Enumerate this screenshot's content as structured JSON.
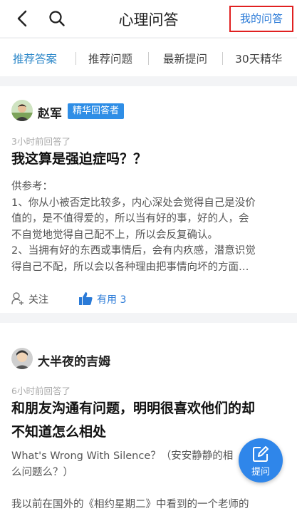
{
  "header": {
    "title": "心理问答",
    "my_answers_label": "我的问答",
    "back_icon": "chevron-left-icon",
    "search_icon": "search-icon"
  },
  "tabs": [
    {
      "label": "推荐答案",
      "active": true
    },
    {
      "label": "推荐问题",
      "active": false
    },
    {
      "label": "最新提问",
      "active": false
    },
    {
      "label": "30天精华",
      "active": false
    }
  ],
  "cards": [
    {
      "author": "赵军",
      "badge": "精华回答者",
      "time": "3小时前回答了",
      "question": "我这算是强迫症吗？？",
      "answer_lines": [
        "供参考：",
        "1、你从小被否定比较多，内心深处会觉得自己是没价",
        "值的，是不值得爱的，所以当有好的事，好的人，会",
        "不自觉地觉得自己配不上，所以会反复确认。",
        "2、当拥有好的东西或事情后，会有内疚感，潜意识觉",
        "得自己不配，所以会以各种理由把事情向坏的方面…"
      ],
      "follow_label": "关注",
      "useful_label": "有用 3"
    },
    {
      "author": "大半夜的吉姆",
      "time": "6小时前回答了",
      "question_lines": [
        "和朋友沟通有问题，明明很喜欢他们的却",
        "不知道怎么相处"
      ],
      "answer_lines": [
        "What's Wrong With Silence？（安安静静的相",
        "么问题么？）",
        "",
        "我以前在国外的《相约星期二》中看到的一个老师的"
      ]
    }
  ],
  "fab": {
    "label": "提问",
    "icon": "edit-icon"
  },
  "colors": {
    "accent": "#2a7ad7",
    "badge": "#2f8ee6",
    "highlight_border": "#e02020"
  }
}
